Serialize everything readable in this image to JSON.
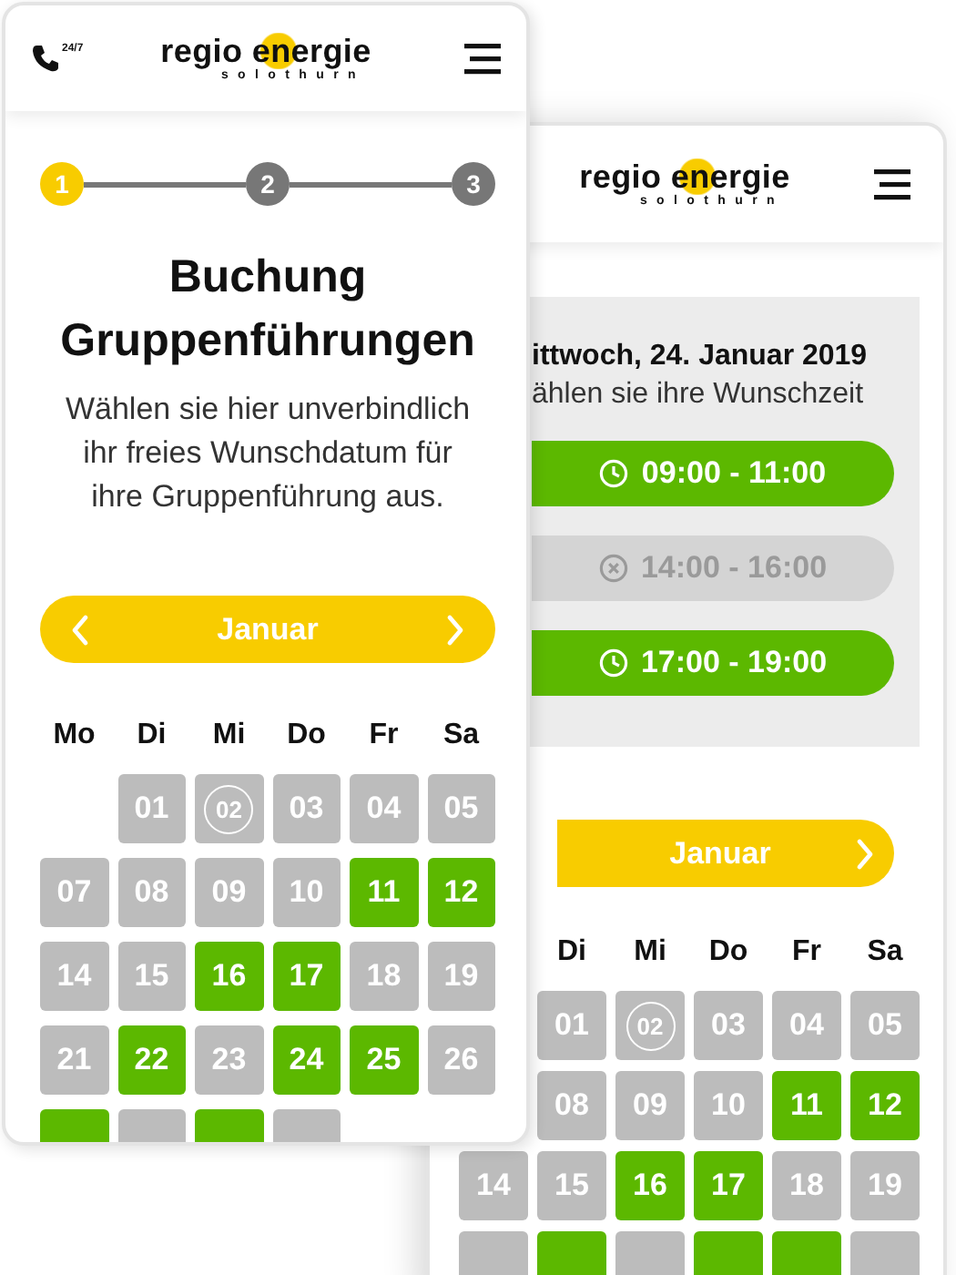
{
  "front_screen": {
    "header": {
      "hotline_label": "24/7",
      "logo": {
        "name": "regio energie",
        "subtitle": "solothurn"
      }
    },
    "steps": [
      {
        "label": "1",
        "selected": true
      },
      {
        "label": "2",
        "selected": false
      },
      {
        "label": "3",
        "selected": false
      }
    ],
    "title": "Buchung Gruppenführungen",
    "intro": "Wählen sie hier unverbindlich ihr freies Wunschdatum für ihre Gruppenführung aus.",
    "month": {
      "label": "Januar",
      "prev_arrow": true,
      "next_arrow": true
    },
    "weekdays": [
      {
        "kind": "label",
        "label": "Mo"
      },
      {
        "kind": "label",
        "label": "Di"
      },
      {
        "kind": "label",
        "label": "Mi"
      },
      {
        "kind": "label",
        "label": "Do"
      },
      {
        "kind": "label",
        "label": "Fr"
      },
      {
        "kind": "label",
        "label": "Sa"
      }
    ],
    "weeks": [
      [
        {
          "kind": "blank"
        },
        {
          "kind": "day",
          "label": "01",
          "available": false,
          "today": false
        },
        {
          "kind": "day",
          "label": "02",
          "available": false,
          "today": true
        },
        {
          "kind": "day",
          "label": "03",
          "available": false,
          "today": false
        },
        {
          "kind": "day",
          "label": "04",
          "available": false,
          "today": false
        },
        {
          "kind": "day",
          "label": "05",
          "available": false,
          "today": false
        }
      ],
      [
        {
          "kind": "day",
          "label": "07",
          "available": false,
          "today": false
        },
        {
          "kind": "day",
          "label": "08",
          "available": false,
          "today": false
        },
        {
          "kind": "day",
          "label": "09",
          "available": false,
          "today": false
        },
        {
          "kind": "day",
          "label": "10",
          "available": false,
          "today": false
        },
        {
          "kind": "day",
          "label": "11",
          "available": true,
          "today": false
        },
        {
          "kind": "day",
          "label": "12",
          "available": true,
          "today": false
        }
      ],
      [
        {
          "kind": "day",
          "label": "14",
          "available": false,
          "today": false
        },
        {
          "kind": "day",
          "label": "15",
          "available": false,
          "today": false
        },
        {
          "kind": "day",
          "label": "16",
          "available": true,
          "today": false
        },
        {
          "kind": "day",
          "label": "17",
          "available": true,
          "today": false
        },
        {
          "kind": "day",
          "label": "18",
          "available": false,
          "today": false
        },
        {
          "kind": "day",
          "label": "19",
          "available": false,
          "today": false
        }
      ],
      [
        {
          "kind": "day",
          "label": "21",
          "available": false,
          "today": false
        },
        {
          "kind": "day",
          "label": "22",
          "available": true,
          "today": false
        },
        {
          "kind": "day",
          "label": "23",
          "available": false,
          "today": false
        },
        {
          "kind": "day",
          "label": "24",
          "available": true,
          "today": false
        },
        {
          "kind": "day",
          "label": "25",
          "available": true,
          "today": false
        },
        {
          "kind": "day",
          "label": "26",
          "available": false,
          "today": false
        }
      ],
      [
        {
          "kind": "day",
          "available": true,
          "today": false
        },
        {
          "kind": "day",
          "available": false,
          "today": false
        },
        {
          "kind": "day",
          "available": true,
          "today": false
        },
        {
          "kind": "day",
          "available": false,
          "today": false
        },
        {
          "kind": "blank"
        },
        {
          "kind": "blank"
        }
      ]
    ]
  },
  "back_screen": {
    "header": {
      "logo": {
        "name": "regio energie",
        "subtitle": "solothurn"
      }
    },
    "slot_panel": {
      "date": "ittwoch, 24. Januar 2019",
      "hint": "ählen sie ihre Wunschzeit",
      "slots": [
        {
          "label": "09:00 - 11:00",
          "disabled": false
        },
        {
          "label": "14:00 - 16:00",
          "disabled": true
        },
        {
          "label": "17:00 - 19:00",
          "disabled": false
        }
      ]
    },
    "month": {
      "label": "Januar",
      "prev_arrow": false,
      "next_arrow": true
    },
    "weekdays": [
      {
        "kind": "blank"
      },
      {
        "kind": "label",
        "label": "Di"
      },
      {
        "kind": "label",
        "label": "Mi"
      },
      {
        "kind": "label",
        "label": "Do"
      },
      {
        "kind": "label",
        "label": "Fr"
      },
      {
        "kind": "label",
        "label": "Sa"
      }
    ],
    "weeks": [
      [
        {
          "kind": "blank"
        },
        {
          "kind": "day",
          "label": "01",
          "available": false,
          "today": false
        },
        {
          "kind": "day",
          "label": "02",
          "available": false,
          "today": true
        },
        {
          "kind": "day",
          "label": "03",
          "available": false,
          "today": false
        },
        {
          "kind": "day",
          "label": "04",
          "available": false,
          "today": false
        },
        {
          "kind": "day",
          "label": "05",
          "available": false,
          "today": false
        }
      ],
      [
        {
          "kind": "blank"
        },
        {
          "kind": "day",
          "label": "08",
          "available": false,
          "today": false
        },
        {
          "kind": "day",
          "label": "09",
          "available": false,
          "today": false
        },
        {
          "kind": "day",
          "label": "10",
          "available": false,
          "today": false
        },
        {
          "kind": "day",
          "label": "11",
          "available": true,
          "today": false
        },
        {
          "kind": "day",
          "label": "12",
          "available": true,
          "today": false
        }
      ],
      [
        {
          "kind": "day",
          "label": "14",
          "available": false,
          "today": false
        },
        {
          "kind": "day",
          "label": "15",
          "available": false,
          "today": false
        },
        {
          "kind": "day",
          "label": "16",
          "available": true,
          "today": false
        },
        {
          "kind": "day",
          "label": "17",
          "available": true,
          "today": false
        },
        {
          "kind": "day",
          "label": "18",
          "available": false,
          "today": false
        },
        {
          "kind": "day",
          "label": "19",
          "available": false,
          "today": false
        }
      ],
      [
        {
          "kind": "day",
          "available": false,
          "today": false
        },
        {
          "kind": "day",
          "available": true,
          "today": false
        },
        {
          "kind": "day",
          "available": false,
          "today": false
        },
        {
          "kind": "day",
          "available": true,
          "today": false
        },
        {
          "kind": "day",
          "available": true,
          "today": false
        },
        {
          "kind": "day",
          "available": false,
          "today": false
        }
      ]
    ]
  }
}
